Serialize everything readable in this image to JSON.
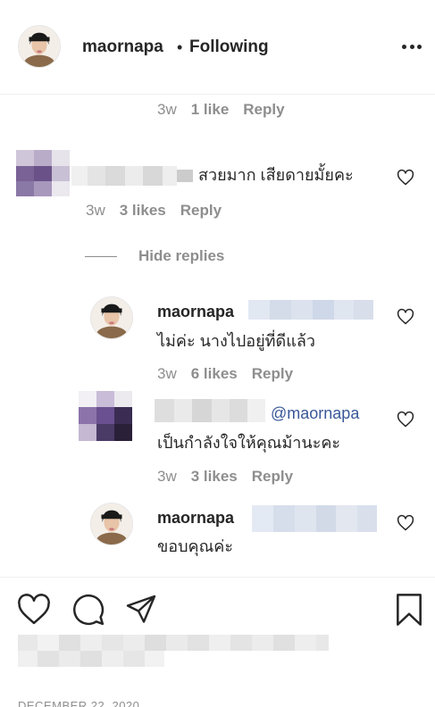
{
  "header": {
    "username": "maornapa",
    "separator": "•",
    "follow_status": "Following",
    "more_icon": "more-horizontal-icon"
  },
  "top_meta": {
    "time": "3w",
    "likes": "1 like",
    "reply": "Reply"
  },
  "comment1": {
    "text": "สวยมาก เสียดายมั้ยคะ",
    "meta": {
      "time": "3w",
      "likes": "3 likes",
      "reply": "Reply"
    }
  },
  "hide_replies": "Hide replies",
  "reply1": {
    "username": "maornapa",
    "text": "ไม่ค่ะ นางไปอยู่ที่ดีแล้ว",
    "meta": {
      "time": "3w",
      "likes": "6 likes",
      "reply": "Reply"
    }
  },
  "reply2": {
    "mention": "@maornapa",
    "text": "เป็นกำลังใจให้คุณม้านะคะ",
    "meta": {
      "time": "3w",
      "likes": "3 likes",
      "reply": "Reply"
    }
  },
  "reply3": {
    "username": "maornapa",
    "text": "ขอบคุณค่ะ"
  },
  "footer": {
    "date": "DECEMBER 22, 2020",
    "icons": [
      "heart-icon",
      "comment-icon",
      "share-icon",
      "bookmark-icon"
    ]
  },
  "colors": {
    "text": "#262626",
    "secondary": "#8e8e8e",
    "mention": "#385898",
    "divider": "#efefef"
  }
}
